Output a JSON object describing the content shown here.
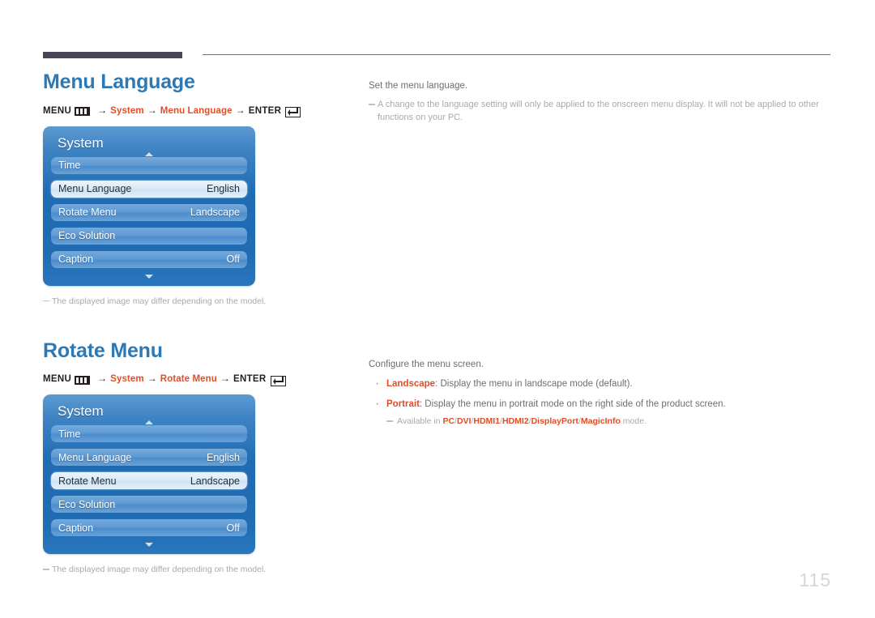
{
  "page": {
    "number": "115"
  },
  "icons": {
    "menu": "menu-icon",
    "enter": "enter-return-icon",
    "caret_up": "caret-up-icon",
    "caret_down": "caret-down-icon"
  },
  "colors": {
    "heading_blue": "#2d79b5",
    "accent_orange": "#e04e27",
    "rule_dark": "#474655",
    "body_gray": "#6d6e71",
    "note_gray": "#a7a9ac",
    "osd_blue": "#1f6cb4",
    "osd_row_blue": "#5f9bd4",
    "osd_row_selected": "#dceaf7",
    "page_number_gray": "#d5d6da"
  },
  "sections": [
    {
      "title": "Menu Language",
      "path": {
        "menu_label": "MENU",
        "crumb1": "System",
        "crumb2": "Menu Language",
        "enter_label": "ENTER",
        "arrow": "→"
      },
      "osd": {
        "title": "System",
        "rows": [
          {
            "label": "Time",
            "value": "",
            "selected": false
          },
          {
            "label": "Menu Language",
            "value": "English",
            "selected": true
          },
          {
            "label": "Rotate Menu",
            "value": "Landscape",
            "selected": false
          },
          {
            "label": "Eco Solution",
            "value": "",
            "selected": false
          },
          {
            "label": "Caption",
            "value": "Off",
            "selected": false
          }
        ]
      },
      "note": "The displayed image may differ depending on the model.",
      "right": {
        "lead": "Set the menu language.",
        "note": "A change to the language setting will only be applied to the onscreen menu display. It will not be applied to other functions on your PC.",
        "bullets": []
      }
    },
    {
      "title": "Rotate Menu",
      "path": {
        "menu_label": "MENU",
        "crumb1": "System",
        "crumb2": "Rotate Menu",
        "enter_label": "ENTER",
        "arrow": "→"
      },
      "osd": {
        "title": "System",
        "rows": [
          {
            "label": "Time",
            "value": "",
            "selected": false
          },
          {
            "label": "Menu Language",
            "value": "English",
            "selected": false
          },
          {
            "label": "Rotate Menu",
            "value": "Landscape",
            "selected": true
          },
          {
            "label": "Eco Solution",
            "value": "",
            "selected": false
          },
          {
            "label": "Caption",
            "value": "Off",
            "selected": false
          }
        ]
      },
      "note": "The displayed image may differ depending on the model.",
      "right": {
        "lead": "Configure the menu screen.",
        "bullets": [
          {
            "keyword": "Landscape",
            "text": ": Display the menu in landscape mode (default)."
          },
          {
            "keyword": "Portrait",
            "text": ": Display the menu in portrait mode on the right side of the product screen."
          }
        ],
        "sub_note": {
          "prefix": "Available in ",
          "modes": [
            "PC",
            "DVI",
            "HDMI1",
            "HDMI2",
            "DisplayPort",
            "MagicInfo"
          ],
          "suffix": " mode."
        }
      }
    }
  ]
}
